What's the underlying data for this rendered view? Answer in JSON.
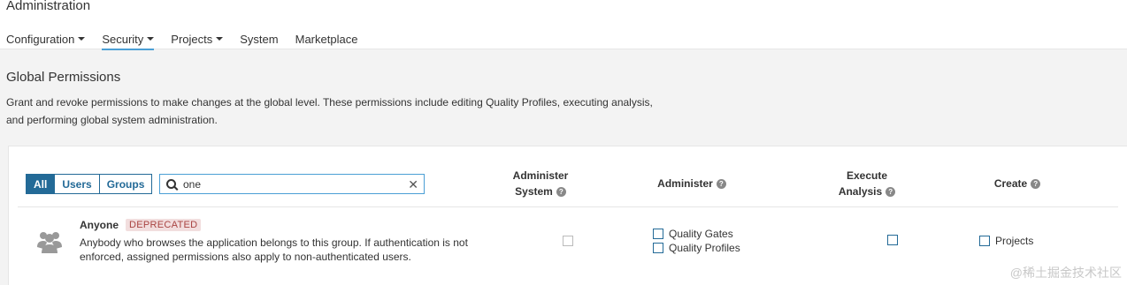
{
  "header": {
    "title": "Administration",
    "nav": [
      {
        "label": "Configuration",
        "dropdown": true,
        "active": false
      },
      {
        "label": "Security",
        "dropdown": true,
        "active": true
      },
      {
        "label": "Projects",
        "dropdown": true,
        "active": false
      },
      {
        "label": "System",
        "dropdown": false,
        "active": false
      },
      {
        "label": "Marketplace",
        "dropdown": false,
        "active": false
      }
    ]
  },
  "section": {
    "title": "Global Permissions",
    "description_line1": "Grant and revoke permissions to make changes at the global level. These permissions include editing Quality Profiles, executing analysis,",
    "description_line2": "and performing global system administration."
  },
  "filter": {
    "all": "All",
    "users": "Users",
    "groups": "Groups",
    "selected": "All"
  },
  "search": {
    "value": "one",
    "clear_icon": "close-icon"
  },
  "columns": {
    "admin_system_1": "Administer",
    "admin_system_2": "System",
    "administer": "Administer",
    "exec_analysis_1": "Execute",
    "exec_analysis_2": "Analysis",
    "create": "Create",
    "help_glyph": "?"
  },
  "row": {
    "name": "Anyone",
    "badge": "DEPRECATED",
    "description": "Anybody who browses the application belongs to this group. If authentication is not enforced, assigned permissions also apply to non-authenticated users.",
    "avatar_icon": "group-icon",
    "quality_gates": "Quality Gates",
    "quality_profiles": "Quality Profiles",
    "projects": "Projects"
  },
  "watermark": "@稀土掘金技术社区",
  "colors": {
    "accent": "#236a97",
    "active_underline": "#4b9fd5",
    "badge_bg": "#f2dede",
    "badge_text": "#a94442"
  }
}
